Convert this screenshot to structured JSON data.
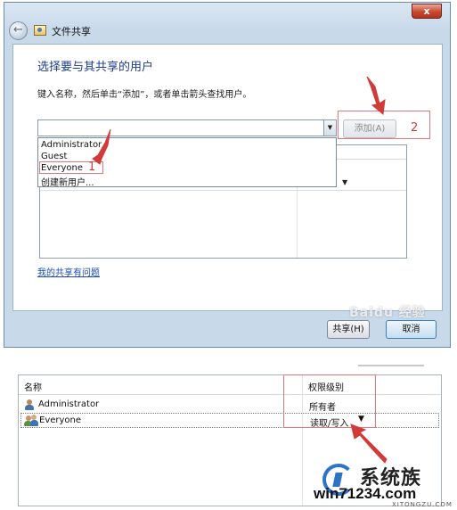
{
  "dialog": {
    "close_label": "x",
    "back_label": "←",
    "title": "文件共享",
    "heading": "选择要与其共享的用户",
    "instruction": "键入名称，然后单击“添加”，或者单击箭头查找用户。",
    "search": {
      "value": ""
    },
    "dropdown_items": [
      "Administrator",
      "Guest",
      "Everyone",
      "创建新用户..."
    ],
    "add_label": "添加(A)",
    "list_header_cols": [
      "",
      ""
    ],
    "link_problem": "我的共享有问题",
    "share_label": "共享(H)",
    "cancel_label": "取消",
    "watermark": "Baidu 经验"
  },
  "annotations": {
    "one": "1",
    "two": "2"
  },
  "permissions": {
    "col_name": "名称",
    "col_level": "权限级别",
    "rows": [
      {
        "name": "Administrator",
        "level": "所有者"
      },
      {
        "name": "Everyone",
        "level": "读取/写入"
      }
    ]
  },
  "logo": {
    "brand": "系统族",
    "site": "win71234.com",
    "sub": "XITONGZU.COM"
  },
  "colors": {
    "annotation_red": "#d23a3a",
    "link_blue": "#1a49b5",
    "heading_blue": "#1f3d8a",
    "logo_blue": "#2c74c6"
  },
  "icons": [
    "back-arrow-icon",
    "share-folder-icon",
    "close-icon",
    "dropdown-arrow-icon",
    "user-icon",
    "group-icon"
  ]
}
